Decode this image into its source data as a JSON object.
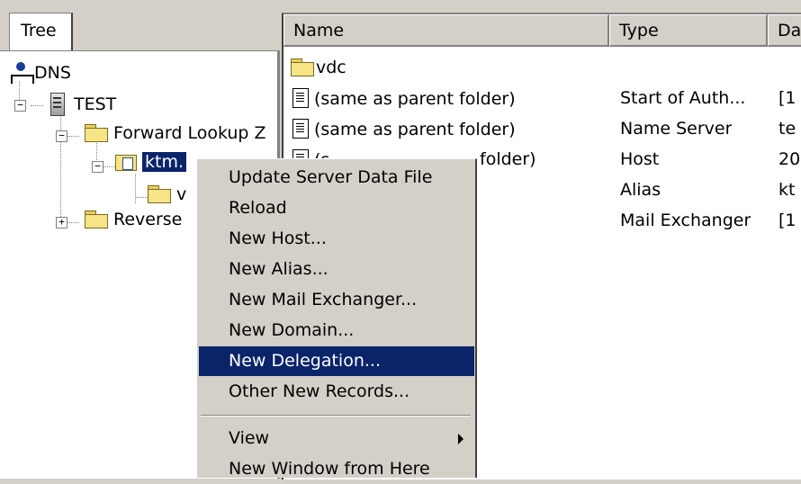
{
  "tree_tab": {
    "label": "Tree"
  },
  "tree": {
    "root": "DNS",
    "server": "TEST",
    "forward_zone": "Forward Lookup Z",
    "zone": "ktm.",
    "subfolder": "v",
    "reverse_zone": "Reverse"
  },
  "columns": {
    "name": "Name",
    "type": "Type",
    "data": "Da"
  },
  "records": [
    {
      "name": "vdc",
      "type": "",
      "data": "",
      "icon": "folder-icon"
    },
    {
      "name": "(same as parent folder)",
      "type": "Start of Auth...",
      "data": "[1",
      "icon": "record-icon"
    },
    {
      "name": "(same as parent folder)",
      "type": "Name Server",
      "data": "te",
      "icon": "record-icon"
    },
    {
      "name": "(s",
      "name_tail": "folder)",
      "type": "Host",
      "data": "20",
      "icon": "record-icon"
    },
    {
      "name": "",
      "type": "Alias",
      "data": "kt",
      "icon": ""
    },
    {
      "name": "",
      "type": "Mail Exchanger",
      "data": "[1",
      "icon": ""
    }
  ],
  "context_menu": {
    "items": [
      "Update Server Data File",
      "Reload",
      "New Host...",
      "New Alias...",
      "New Mail Exchanger...",
      "New Domain...",
      "New Delegation...",
      "Other New Records...",
      "View",
      "New Window from Here"
    ],
    "highlighted": "New Delegation..."
  },
  "colors": {
    "selection": "#0a246a",
    "face": "#d4d0c8"
  }
}
